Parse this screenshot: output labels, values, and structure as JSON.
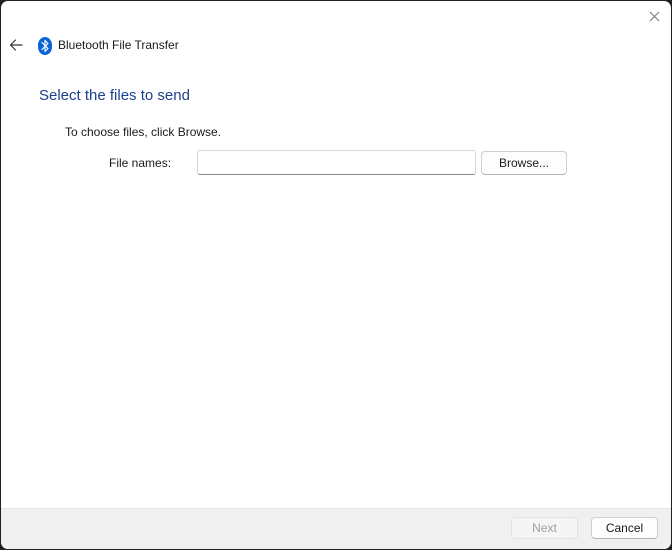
{
  "window": {
    "title": "Bluetooth File Transfer"
  },
  "page": {
    "heading": "Select the files to send",
    "instruction": "To choose files, click Browse.",
    "file_names_label": "File names:",
    "file_names_value": "",
    "browse_label": "Browse..."
  },
  "footer": {
    "next_label": "Next",
    "next_enabled": false,
    "cancel_label": "Cancel"
  },
  "icons": {
    "close": "close-icon",
    "back": "back-arrow-icon",
    "app": "bluetooth-icon"
  },
  "colors": {
    "heading": "#1b3f8b",
    "bluetooth": "#0a64d8",
    "footer_bg": "#f0f0f0"
  }
}
